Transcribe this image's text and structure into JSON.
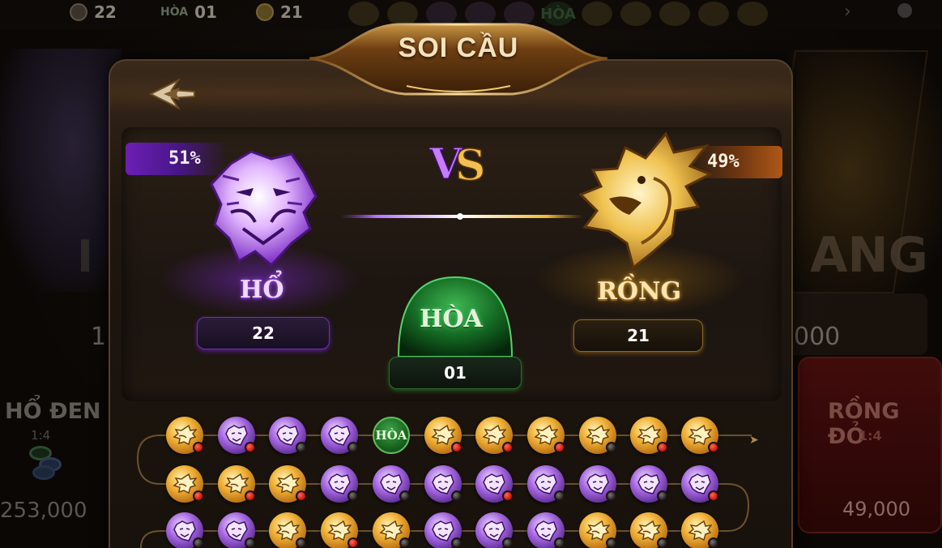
{
  "background": {
    "topbar": {
      "tiger_count": "22",
      "hoa_label": "HÒA",
      "hoa_count": "01",
      "dragon_count": "21",
      "history_hoa": "HÒA"
    },
    "left_amount_partial": "1",
    "right_amount_partial": "000",
    "left_bet_title": "HỔ ĐEN",
    "left_bet_ratio": "1:4",
    "left_total": "253,000",
    "right_bet_title": "RỒNG ĐỎ",
    "right_bet_ratio": "1:4",
    "right_total": "49,000",
    "left_banner_partial": "I",
    "right_banner_partial": "ANG"
  },
  "popup": {
    "title": "SOI CẦU",
    "back_icon": "back-arrow-icon",
    "vs_label": "VS",
    "tiger": {
      "name": "HỔ",
      "percent": "51%",
      "count": "22",
      "color": "#9b4de0"
    },
    "dragon": {
      "name": "RỒNG",
      "percent": "49%",
      "count": "21",
      "color": "#e0a53a"
    },
    "tie": {
      "name": "HÒA",
      "count": "01",
      "color": "#2e8a3a"
    }
  },
  "road_map": {
    "rows": [
      [
        {
          "side": "dragon",
          "mark": "red"
        },
        {
          "side": "tiger",
          "mark": "red"
        },
        {
          "side": "tiger",
          "mark": "black"
        },
        {
          "side": "tiger",
          "mark": "black"
        },
        {
          "side": "hoa",
          "label": "HÒA"
        },
        {
          "side": "dragon",
          "mark": "red"
        },
        {
          "side": "dragon",
          "mark": "red"
        },
        {
          "side": "dragon",
          "mark": "red"
        },
        {
          "side": "dragon",
          "mark": "black"
        },
        {
          "side": "dragon",
          "mark": "red"
        },
        {
          "side": "dragon",
          "mark": "red"
        }
      ],
      [
        {
          "side": "dragon",
          "mark": "red"
        },
        {
          "side": "dragon",
          "mark": "red"
        },
        {
          "side": "dragon",
          "mark": "red"
        },
        {
          "side": "tiger",
          "mark": "black"
        },
        {
          "side": "tiger",
          "mark": "black"
        },
        {
          "side": "tiger",
          "mark": "black"
        },
        {
          "side": "tiger",
          "mark": "red"
        },
        {
          "side": "tiger",
          "mark": "black"
        },
        {
          "side": "tiger",
          "mark": "black"
        },
        {
          "side": "tiger",
          "mark": "black"
        },
        {
          "side": "tiger",
          "mark": "red"
        }
      ],
      [
        {
          "side": "tiger",
          "mark": "black"
        },
        {
          "side": "tiger",
          "mark": "black"
        },
        {
          "side": "dragon",
          "mark": "black"
        },
        {
          "side": "dragon",
          "mark": "red"
        },
        {
          "side": "dragon",
          "mark": "black"
        },
        {
          "side": "tiger",
          "mark": "black"
        },
        {
          "side": "tiger",
          "mark": "black"
        },
        {
          "side": "tiger",
          "mark": "black"
        },
        {
          "side": "dragon",
          "mark": "black"
        },
        {
          "side": "dragon",
          "mark": "black"
        },
        {
          "side": "dragon",
          "mark": "black"
        }
      ]
    ]
  }
}
